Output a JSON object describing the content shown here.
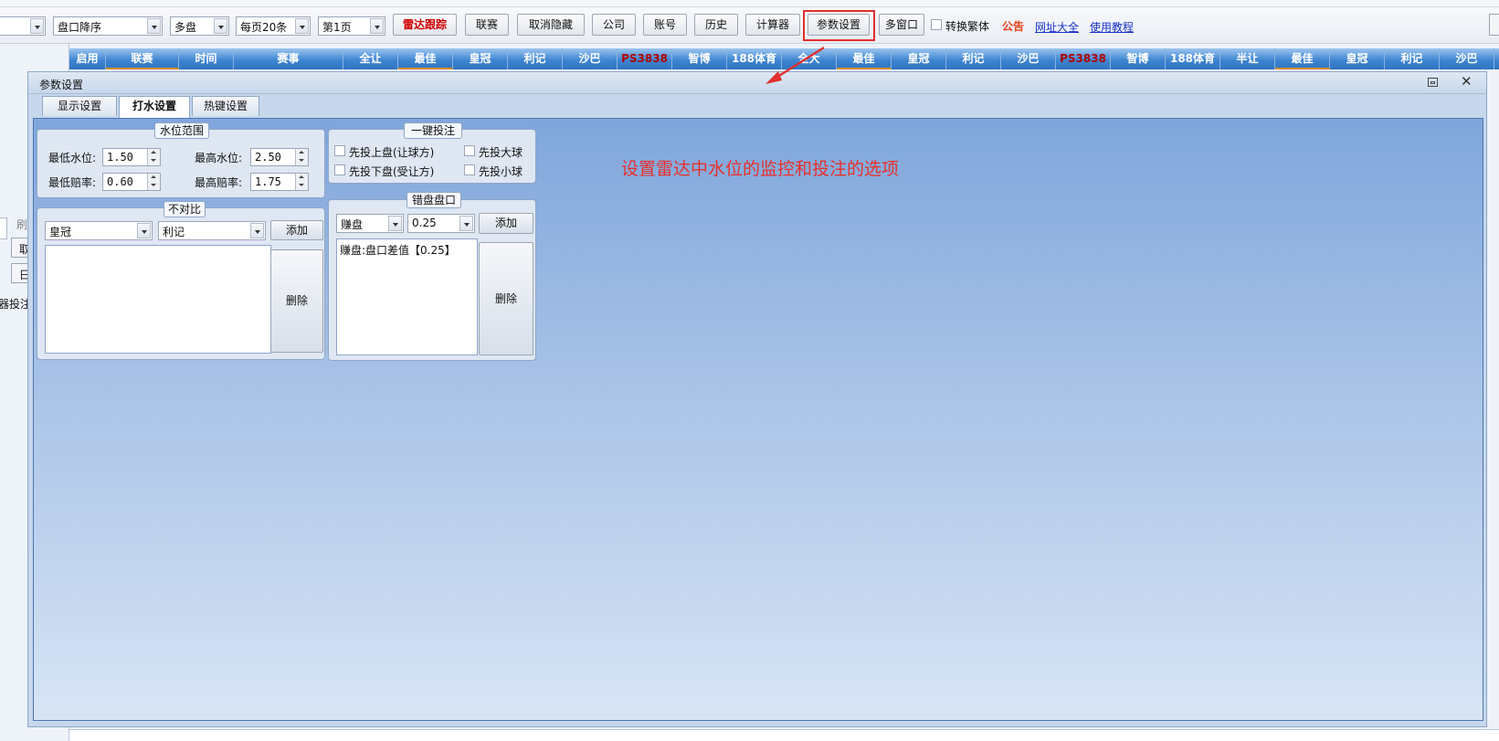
{
  "toolbar": {
    "sort": "盘口降序",
    "market": "多盘",
    "per_page": "每页20条",
    "page": "第1页",
    "buttons": [
      "雷达跟踪",
      "联赛",
      "取消隐藏",
      "公司",
      "账号",
      "历史",
      "计算器",
      "参数设置",
      "多窗口"
    ],
    "traditional_label": "转换繁体",
    "notice": "公告",
    "links": [
      "网址大全",
      "使用教程"
    ]
  },
  "columns": [
    "启用",
    "联赛",
    "时间",
    "赛事",
    "全让",
    "最佳",
    "皇冠",
    "利记",
    "沙巴",
    "PS3838",
    "智博",
    "188体育",
    "全大",
    "最佳",
    "皇冠",
    "利记",
    "沙巴",
    "PS3838",
    "智博",
    "188体育",
    "半让",
    "最佳",
    "皇冠",
    "利记",
    "沙巴"
  ],
  "left_fragments": [
    "刷",
    "取",
    "日",
    "器投注"
  ],
  "dialog": {
    "title": "参数设置",
    "tabs": [
      "显示设置",
      "打水设置",
      "热键设置"
    ],
    "water_range": {
      "title": "水位范围",
      "min_water_label": "最低水位:",
      "min_water": "1.50",
      "max_water_label": "最高水位:",
      "max_water": "2.50",
      "min_odds_label": "最低赔率:",
      "min_odds": "0.60",
      "max_odds_label": "最高赔率:",
      "max_odds": "1.75"
    },
    "one_click": {
      "title": "一键投注",
      "options": [
        "先投上盘(让球方)",
        "先投大球",
        "先投下盘(受让方)",
        "先投小球"
      ]
    },
    "no_compare": {
      "title": "不对比",
      "company_a": "皇冠",
      "company_b": "利记",
      "add": "添加",
      "delete": "删除"
    },
    "wrong_line": {
      "title": "错盘盘口",
      "type": "赚盘",
      "value": "0.25",
      "add": "添加",
      "delete": "删除",
      "items": [
        "赚盘:盘口差值【0.25】"
      ]
    },
    "annotation": "设置雷达中水位的监控和投注的选项"
  },
  "colors": {
    "annotation": "#e8302a",
    "highlight": "#e03030",
    "header": "#3f86d2",
    "ps_text": "#b00000"
  }
}
